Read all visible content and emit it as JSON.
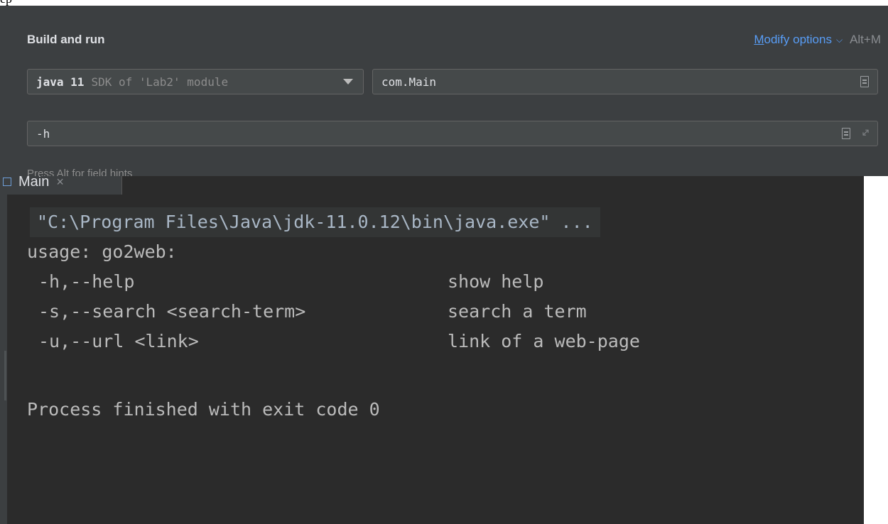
{
  "top_strip": {
    "text": "ep"
  },
  "config": {
    "section_title": "Build and run",
    "modify_options": {
      "mnemonic": "M",
      "label_rest": "odify options",
      "shortcut": "Alt+M"
    },
    "sdk": {
      "name": "java 11",
      "description": "SDK of 'Lab2' module"
    },
    "main_class": "com.Main",
    "program_args": "-h",
    "hint": "Press Alt for field hints"
  },
  "run_window": {
    "tab_label": "Main",
    "tab_close": "×",
    "console": {
      "command": "\"C:\\Program Files\\Java\\jdk-11.0.12\\bin\\java.exe\" ...",
      "usage": "usage: go2web:",
      "options": [
        {
          "flag": "-h,--help",
          "description": "show help"
        },
        {
          "flag": "-s,--search <search-term>",
          "description": "search a term"
        },
        {
          "flag": "-u,--url <link>",
          "description": "link of a web-page"
        }
      ],
      "exit_message": "Process finished with exit code 0"
    }
  },
  "colors": {
    "panel_bg": "#3c3f41",
    "console_bg": "#2b2b2b",
    "link": "#589df6",
    "text": "#bbbbbb"
  }
}
